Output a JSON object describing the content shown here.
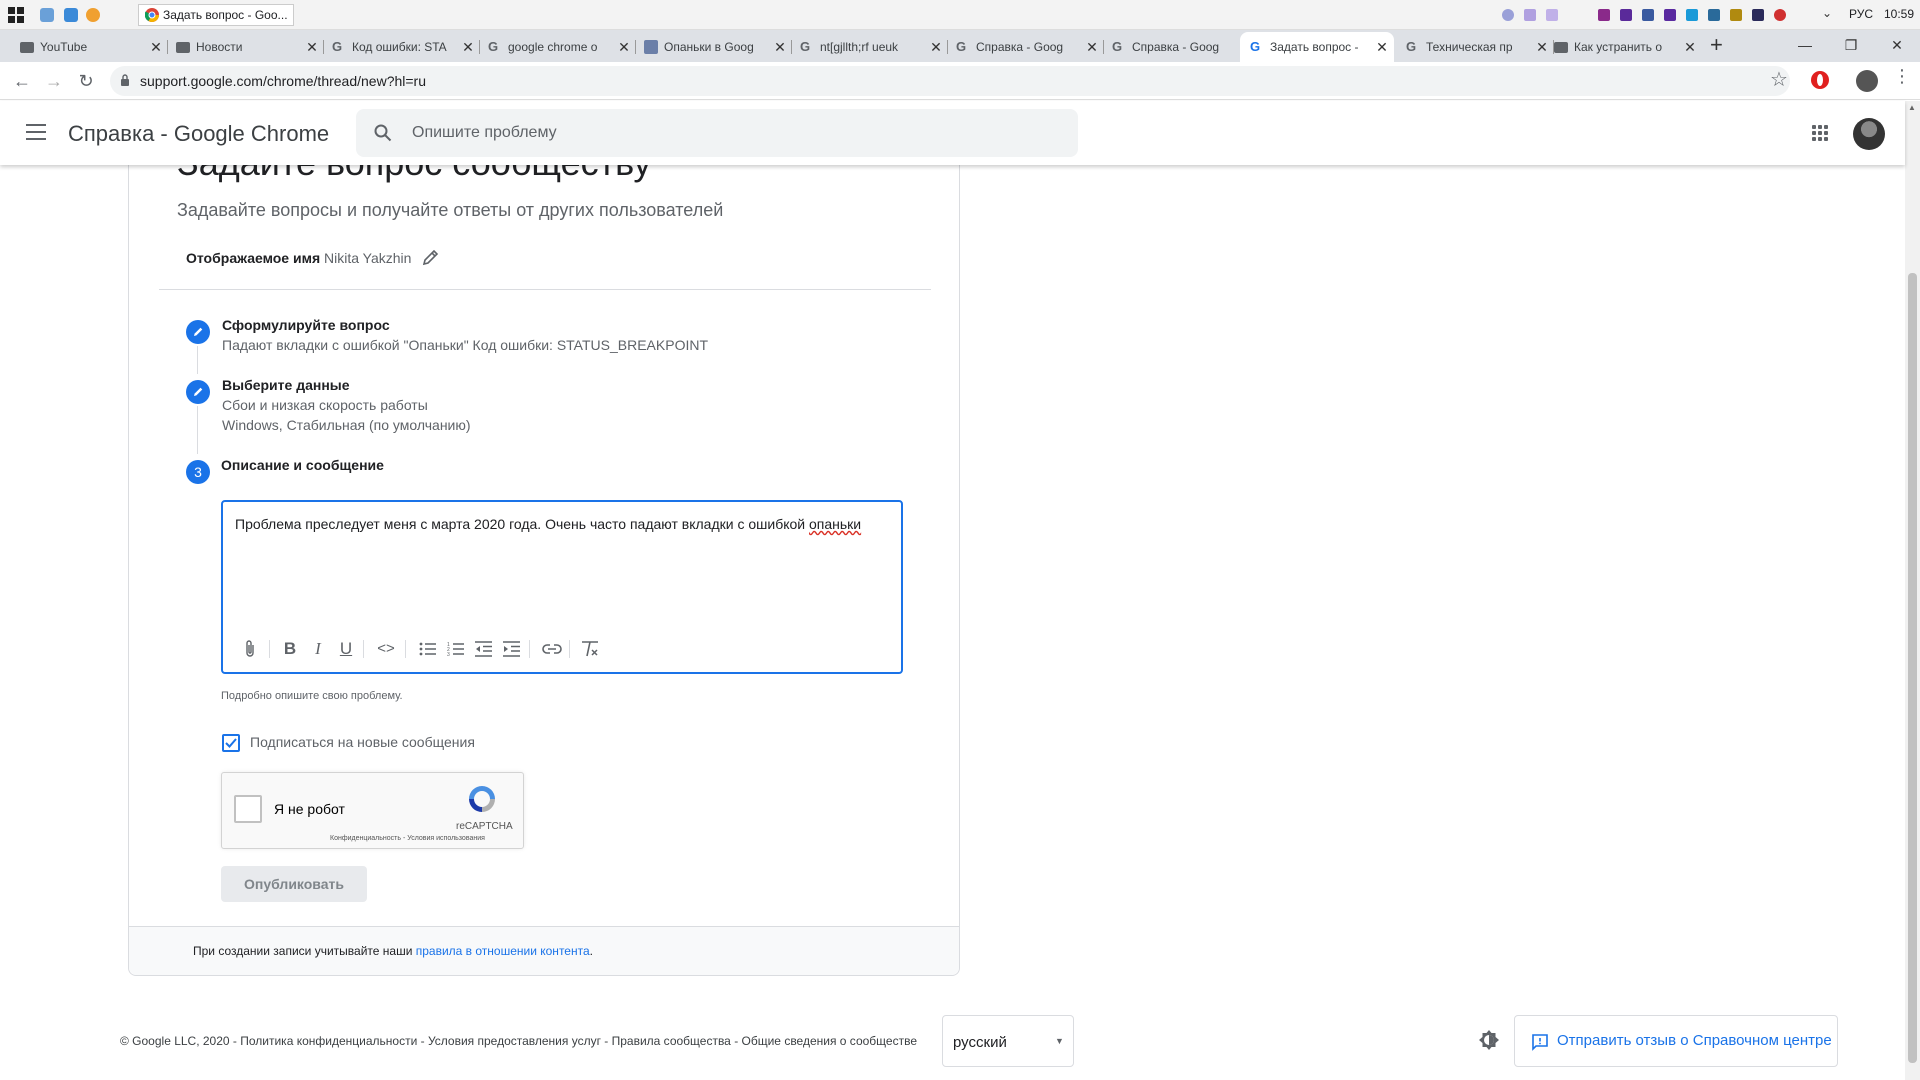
{
  "os": {
    "active_window_title": "Задать вопрос - Goo...",
    "language": "РУС",
    "time": "10:59"
  },
  "browser": {
    "tabs": [
      {
        "label": "YouTube",
        "icon": "folder-icon"
      },
      {
        "label": "Новости",
        "icon": "folder-icon"
      },
      {
        "label": "Код ошибки: STA",
        "icon": "google-icon"
      },
      {
        "label": "google chrome о",
        "icon": "google-icon"
      },
      {
        "label": "Опаньки в Goog",
        "icon": "site-icon"
      },
      {
        "label": "nt[gjllth;rf ueuk",
        "icon": "google-icon"
      },
      {
        "label": "Справка - Goog",
        "icon": "google-icon"
      },
      {
        "label": "Справка - Goog",
        "icon": "google-icon"
      },
      {
        "label": "Задать вопрос -",
        "icon": "google-icon",
        "active": true
      },
      {
        "label": "Техническая пр",
        "icon": "google-icon"
      },
      {
        "label": "Как устранить о",
        "icon": "folder-icon"
      }
    ],
    "url": "support.google.com/chrome/thread/new?hl=ru"
  },
  "header": {
    "title": "Справка - Google Chrome",
    "search_placeholder": "Опишите проблему"
  },
  "form": {
    "title": "Задайте вопрос сообществу",
    "subtitle": "Задавайте вопросы и получайте ответы от других пользователей",
    "display_name_label": "Отображаемое имя",
    "display_name_value": "Nikita Yakzhin",
    "steps": [
      {
        "title": "Сформулируйте вопрос",
        "details": [
          "Падают вкладки с ошибкой \"Опаньки\" Код ошибки: STATUS_BREAKPOINT"
        ]
      },
      {
        "title": "Выберите данные",
        "details": [
          "Сбои и низкая скорость работы",
          "Windows, Стабильная (по умолчанию)"
        ]
      },
      {
        "number": "3",
        "title": "Описание и сообщение"
      }
    ],
    "editor_text_before": "Проблема преследует меня с марта 2020 года. Очень часто падают вкладки с ошибкой ",
    "editor_text_misspelled": "опаньки",
    "editor_hint": "Подробно опишите свою проблему.",
    "subscribe_label": "Подписаться на новые сообщения",
    "subscribe_checked": true,
    "captcha": {
      "label": "Я не робот",
      "brand": "reCAPTCHA",
      "links": "Конфиденциальность - Условия использования"
    },
    "publish_label": "Опубликовать",
    "footer_text": "При создании записи учитывайте наши ",
    "footer_link": "правила в отношении контента",
    "footer_end": "."
  },
  "footer": {
    "links": "© Google LLC, 2020 - Политика конфиденциальности - Условия предоставления услуг - Правила сообщества - Общие сведения о сообществе",
    "language": "русский",
    "feedback_label": "Отправить отзыв о Справочном центре"
  },
  "colors": {
    "accent": "#1a73e8",
    "tabbar": "#dee1e6",
    "spell_error": "#d93025"
  }
}
